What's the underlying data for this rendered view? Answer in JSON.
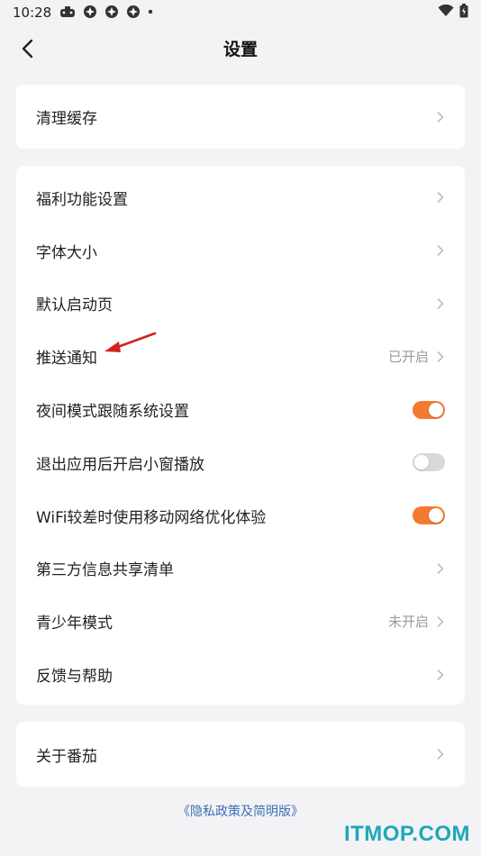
{
  "status_bar": {
    "time": "10:28"
  },
  "header": {
    "title": "设置"
  },
  "card1": {
    "rows": [
      {
        "label": "清理缓存"
      }
    ]
  },
  "card2": {
    "rows": [
      {
        "label": "福利功能设置"
      },
      {
        "label": "字体大小"
      },
      {
        "label": "默认启动页"
      },
      {
        "label": "推送通知",
        "value": "已开启"
      },
      {
        "label": "夜间模式跟随系统设置",
        "toggle": "on"
      },
      {
        "label": "退出应用后开启小窗播放",
        "toggle": "off"
      },
      {
        "label": "WiFi较差时使用移动网络优化体验",
        "toggle": "on"
      },
      {
        "label": "第三方信息共享清单"
      },
      {
        "label": "青少年模式",
        "value": "未开启"
      },
      {
        "label": "反馈与帮助"
      }
    ]
  },
  "card3": {
    "rows": [
      {
        "label": "关于番茄"
      }
    ]
  },
  "footer": {
    "privacy_link": "《隐私政策及简明版》"
  },
  "watermark": "ITMOP.COM",
  "colors": {
    "accent": "#f47a30",
    "link": "#3f6fb6",
    "background": "#f3f3f5"
  }
}
